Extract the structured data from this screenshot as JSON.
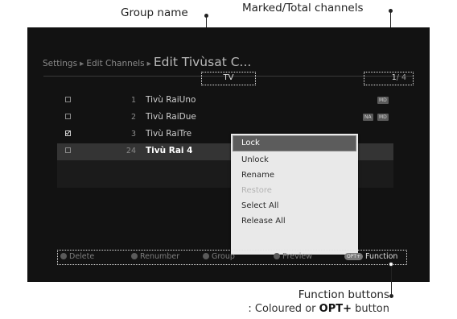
{
  "callouts": {
    "group_name": "Group name",
    "marked_total": "Marked/Total channels",
    "function_buttons": "Function buttons",
    "function_sub_prefix": ": Coloured or ",
    "function_sub_bold": "OPT+",
    "function_sub_suffix": " button"
  },
  "breadcrumb": {
    "item1": "Settings",
    "item2": "Edit Channels",
    "current": "Edit Tivùsat C...",
    "separator": "▸"
  },
  "group": {
    "name": "TV"
  },
  "counter": {
    "marked": "1",
    "total": "/ 4"
  },
  "channels": [
    {
      "checked": false,
      "number": "1",
      "name": "Tivù RaiUno",
      "tags": [
        "MD"
      ]
    },
    {
      "checked": false,
      "number": "2",
      "name": "Tivù RaiDue",
      "tags": [
        "NA",
        "MD"
      ]
    },
    {
      "checked": true,
      "number": "3",
      "name": "Tivù RaiTre",
      "tags": []
    },
    {
      "checked": false,
      "number": "24",
      "name": "Tivù Rai 4",
      "tags": []
    }
  ],
  "menu": {
    "items": [
      {
        "label": "Lock",
        "state": "active"
      },
      {
        "label": "Unlock",
        "state": "normal"
      },
      {
        "label": "Rename",
        "state": "normal"
      },
      {
        "label": "Restore",
        "state": "disabled"
      },
      {
        "label": "Select All",
        "state": "normal"
      },
      {
        "label": "Release All",
        "state": "normal"
      }
    ]
  },
  "function_bar": {
    "delete": "Delete",
    "renumber": "Renumber",
    "group": "Group",
    "preview": "Preview",
    "opt_badge": "OPT+",
    "function": "Function"
  }
}
